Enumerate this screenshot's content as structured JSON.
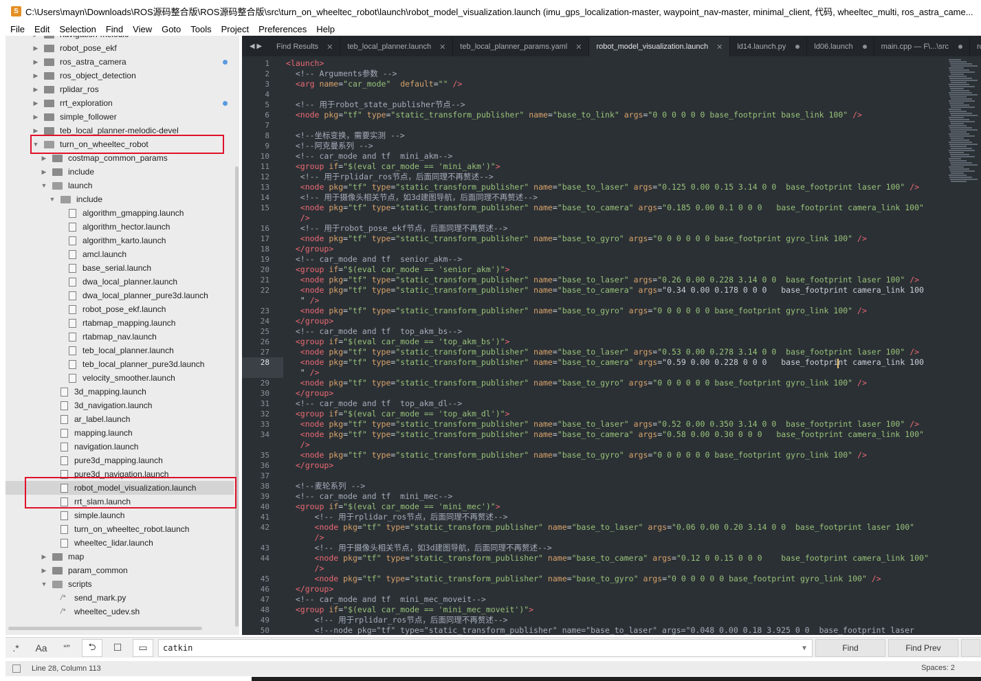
{
  "window": {
    "title": "C:\\Users\\mayn\\Downloads\\ROS源码整合版\\ROS源码整合版\\src\\turn_on_wheeltec_robot\\launch\\robot_model_visualization.launch (imu_gps_localization-master, waypoint_nav-master, minimal_client, 代码, wheeltec_multi, ros_astra_came..."
  },
  "menu": [
    "File",
    "Edit",
    "Selection",
    "Find",
    "View",
    "Goto",
    "Tools",
    "Project",
    "Preferences",
    "Help"
  ],
  "sidebar": {
    "items": [
      {
        "label": "navigation-melodic",
        "type": "folder",
        "depth": 0,
        "expanded": false
      },
      {
        "label": "robot_pose_ekf",
        "type": "folder",
        "depth": 0,
        "expanded": false
      },
      {
        "label": "ros_astra_camera",
        "type": "folder",
        "depth": 0,
        "expanded": false,
        "modified": true
      },
      {
        "label": "ros_object_detection",
        "type": "folder",
        "depth": 0,
        "expanded": false
      },
      {
        "label": "rplidar_ros",
        "type": "folder",
        "depth": 0,
        "expanded": false
      },
      {
        "label": "rrt_exploration",
        "type": "folder",
        "depth": 0,
        "expanded": false,
        "modified": true
      },
      {
        "label": "simple_follower",
        "type": "folder",
        "depth": 0,
        "expanded": false
      },
      {
        "label": "teb_local_planner-melodic-devel",
        "type": "folder",
        "depth": 0,
        "expanded": false
      },
      {
        "label": "turn_on_wheeltec_robot",
        "type": "folder",
        "depth": 0,
        "expanded": true
      },
      {
        "label": "costmap_common_params",
        "type": "folder",
        "depth": 1,
        "expanded": false
      },
      {
        "label": "include",
        "type": "folder",
        "depth": 1,
        "expanded": false
      },
      {
        "label": "launch",
        "type": "folder",
        "depth": 1,
        "expanded": true
      },
      {
        "label": "include",
        "type": "folder",
        "depth": 2,
        "expanded": true
      },
      {
        "label": "algorithm_gmapping.launch",
        "type": "file",
        "depth": 3
      },
      {
        "label": "algorithm_hector.launch",
        "type": "file",
        "depth": 3
      },
      {
        "label": "algorithm_karto.launch",
        "type": "file",
        "depth": 3
      },
      {
        "label": "amcl.launch",
        "type": "file",
        "depth": 3
      },
      {
        "label": "base_serial.launch",
        "type": "file",
        "depth": 3
      },
      {
        "label": "dwa_local_planner.launch",
        "type": "file",
        "depth": 3
      },
      {
        "label": "dwa_local_planner_pure3d.launch",
        "type": "file",
        "depth": 3
      },
      {
        "label": "robot_pose_ekf.launch",
        "type": "file",
        "depth": 3
      },
      {
        "label": "rtabmap_mapping.launch",
        "type": "file",
        "depth": 3
      },
      {
        "label": "rtabmap_nav.launch",
        "type": "file",
        "depth": 3
      },
      {
        "label": "teb_local_planner.launch",
        "type": "file",
        "depth": 3
      },
      {
        "label": "teb_local_planner_pure3d.launch",
        "type": "file",
        "depth": 3
      },
      {
        "label": "velocity_smoother.launch",
        "type": "file",
        "depth": 3
      },
      {
        "label": "3d_mapping.launch",
        "type": "file",
        "depth": 2
      },
      {
        "label": "3d_navigation.launch",
        "type": "file",
        "depth": 2
      },
      {
        "label": "ar_label.launch",
        "type": "file",
        "depth": 2
      },
      {
        "label": "mapping.launch",
        "type": "file",
        "depth": 2
      },
      {
        "label": "navigation.launch",
        "type": "file",
        "depth": 2
      },
      {
        "label": "pure3d_mapping.launch",
        "type": "file",
        "depth": 2
      },
      {
        "label": "pure3d_navigation.launch",
        "type": "file",
        "depth": 2
      },
      {
        "label": "robot_model_visualization.launch",
        "type": "file",
        "depth": 2,
        "selected": true
      },
      {
        "label": "rrt_slam.launch",
        "type": "file",
        "depth": 2
      },
      {
        "label": "simple.launch",
        "type": "file",
        "depth": 2
      },
      {
        "label": "turn_on_wheeltec_robot.launch",
        "type": "file",
        "depth": 2
      },
      {
        "label": "wheeltec_lidar.launch",
        "type": "file",
        "depth": 2
      },
      {
        "label": "map",
        "type": "folder",
        "depth": 1,
        "expanded": false
      },
      {
        "label": "param_common",
        "type": "folder",
        "depth": 1,
        "expanded": false
      },
      {
        "label": "scripts",
        "type": "folder",
        "depth": 1,
        "expanded": true
      },
      {
        "label": "send_mark.py",
        "type": "script",
        "depth": 2
      },
      {
        "label": "wheeltec_udev.sh",
        "type": "script",
        "depth": 2
      }
    ]
  },
  "tabs": [
    {
      "label": "Find Results",
      "state": "close"
    },
    {
      "label": "teb_local_planner.launch",
      "state": "close"
    },
    {
      "label": "teb_local_planner_params.yaml",
      "state": "close"
    },
    {
      "label": "robot_model_visualization.launch",
      "state": "close",
      "active": true
    },
    {
      "label": "ld14.launch.py",
      "state": "dot"
    },
    {
      "label": "ld06.launch",
      "state": "dot"
    },
    {
      "label": "main.cpp — F\\...\\src",
      "state": "dot"
    },
    {
      "label": "rc",
      "state": "none"
    }
  ],
  "editor": {
    "current_line": 28,
    "lines": [
      {
        "n": "1",
        "text": "<launch>"
      },
      {
        "n": "2",
        "text": "  <!-- Arguments参数 -->"
      },
      {
        "n": "3",
        "text": "  <arg name=\"car_mode\"  default=\"\" />"
      },
      {
        "n": "4",
        "text": ""
      },
      {
        "n": "5",
        "text": "  <!-- 用于robot_state_publisher节点-->"
      },
      {
        "n": "6",
        "text": "  <node pkg=\"tf\" type=\"static_transform_publisher\" name=\"base_to_link\" args=\"0 0 0 0 0 0 base_footprint base_link 100\" />"
      },
      {
        "n": "7",
        "text": ""
      },
      {
        "n": "8",
        "text": "  <!--坐标变换，需要实测 -->"
      },
      {
        "n": "9",
        "text": "  <!--阿克曼系列 -->"
      },
      {
        "n": "10",
        "text": "  <!-- car_mode and tf  mini_akm-->"
      },
      {
        "n": "11",
        "text": "  <group if=\"$(eval car_mode == 'mini_akm')\">"
      },
      {
        "n": "12",
        "text": "   <!-- 用于rplidar_ros节点，后面同理不再赘述-->"
      },
      {
        "n": "13",
        "text": "   <node pkg=\"tf\" type=\"static_transform_publisher\" name=\"base_to_laser\" args=\"0.125 0.00 0.15 3.14 0 0  base_footprint laser 100\" />"
      },
      {
        "n": "14",
        "text": "   <!-- 用于摄像头相关节点，如3d建图导航，后面同理不再赘述-->"
      },
      {
        "n": "15",
        "text": "   <node pkg=\"tf\" type=\"static_transform_publisher\" name=\"base_to_camera\" args=\"0.185 0.00 0.1 0 0 0   base_footprint camera_link 100\""
      },
      {
        "n": "",
        "text": "   />"
      },
      {
        "n": "16",
        "text": "   <!-- 用于robot_pose_ekf节点，后面同理不再赘述-->"
      },
      {
        "n": "17",
        "text": "   <node pkg=\"tf\" type=\"static_transform_publisher\" name=\"base_to_gyro\" args=\"0 0 0 0 0 0 base_footprint gyro_link 100\" />"
      },
      {
        "n": "18",
        "text": "  </group>"
      },
      {
        "n": "19",
        "text": "  <!-- car_mode and tf  senior_akm-->"
      },
      {
        "n": "20",
        "text": "  <group if=\"$(eval car_mode == 'senior_akm')\">"
      },
      {
        "n": "21",
        "text": "   <node pkg=\"tf\" type=\"static_transform_publisher\" name=\"base_to_laser\" args=\"0.26 0.00 0.228 3.14 0 0  base_footprint laser 100\" />"
      },
      {
        "n": "22",
        "text": "   <node pkg=\"tf\" type=\"static_transform_publisher\" name=\"base_to_camera\" args=\"0.34 0.00 0.178 0 0 0   base_footprint camera_link 100"
      },
      {
        "n": "",
        "text": "   \" />"
      },
      {
        "n": "23",
        "text": "   <node pkg=\"tf\" type=\"static_transform_publisher\" name=\"base_to_gyro\" args=\"0 0 0 0 0 0 base_footprint gyro_link 100\" />"
      },
      {
        "n": "24",
        "text": "  </group>"
      },
      {
        "n": "25",
        "text": "  <!-- car_mode and tf  top_akm_bs-->"
      },
      {
        "n": "26",
        "text": "  <group if=\"$(eval car_mode == 'top_akm_bs')\">"
      },
      {
        "n": "27",
        "text": "   <node pkg=\"tf\" type=\"static_transform_publisher\" name=\"base_to_laser\" args=\"0.53 0.00 0.278 3.14 0 0  base_footprint laser 100\" />"
      },
      {
        "n": "28",
        "text": "   <node pkg=\"tf\" type=\"static_transform_publisher\" name=\"base_to_camera\" args=\"0.59 0.00 0.228 0 0 0   base_footprint camera_link 100"
      },
      {
        "n": "",
        "text": "   \" />"
      },
      {
        "n": "29",
        "text": "   <node pkg=\"tf\" type=\"static_transform_publisher\" name=\"base_to_gyro\" args=\"0 0 0 0 0 0 base_footprint gyro_link 100\" />"
      },
      {
        "n": "30",
        "text": "  </group>"
      },
      {
        "n": "31",
        "text": "  <!-- car_mode and tf  top_akm_dl-->"
      },
      {
        "n": "32",
        "text": "  <group if=\"$(eval car_mode == 'top_akm_dl')\">"
      },
      {
        "n": "33",
        "text": "   <node pkg=\"tf\" type=\"static_transform_publisher\" name=\"base_to_laser\" args=\"0.52 0.00 0.350 3.14 0 0  base_footprint laser 100\" />"
      },
      {
        "n": "34",
        "text": "   <node pkg=\"tf\" type=\"static_transform_publisher\" name=\"base_to_camera\" args=\"0.58 0.00 0.30 0 0 0   base_footprint camera_link 100\""
      },
      {
        "n": "",
        "text": "   />"
      },
      {
        "n": "35",
        "text": "   <node pkg=\"tf\" type=\"static_transform_publisher\" name=\"base_to_gyro\" args=\"0 0 0 0 0 0 base_footprint gyro_link 100\" />"
      },
      {
        "n": "36",
        "text": "  </group>"
      },
      {
        "n": "37",
        "text": ""
      },
      {
        "n": "38",
        "text": "  <!--麦轮系列 -->"
      },
      {
        "n": "39",
        "text": "  <!-- car_mode and tf  mini_mec-->"
      },
      {
        "n": "40",
        "text": "  <group if=\"$(eval car_mode == 'mini_mec')\">"
      },
      {
        "n": "41",
        "text": "      <!-- 用于rplidar_ros节点，后面同理不再赘述-->"
      },
      {
        "n": "42",
        "text": "      <node pkg=\"tf\" type=\"static_transform_publisher\" name=\"base_to_laser\" args=\"0.06 0.00 0.20 3.14 0 0  base_footprint laser 100\""
      },
      {
        "n": "",
        "text": "      />"
      },
      {
        "n": "43",
        "text": "      <!-- 用于摄像头相关节点，如3d建图导航，后面同理不再赘述-->"
      },
      {
        "n": "44",
        "text": "      <node pkg=\"tf\" type=\"static_transform_publisher\" name=\"base_to_camera\" args=\"0.12 0 0.15 0 0 0    base_footprint camera_link 100\""
      },
      {
        "n": "",
        "text": "      />"
      },
      {
        "n": "45",
        "text": "      <node pkg=\"tf\" type=\"static_transform_publisher\" name=\"base_to_gyro\" args=\"0 0 0 0 0 0 base_footprint gyro_link 100\" />"
      },
      {
        "n": "46",
        "text": "  </group>"
      },
      {
        "n": "47",
        "text": "  <!-- car_mode and tf  mini_mec_moveit-->"
      },
      {
        "n": "48",
        "text": "  <group if=\"$(eval car_mode == 'mini_mec_moveit')\">"
      },
      {
        "n": "49",
        "text": "      <!-- 用于rplidar_ros节点，后面同理不再赘述-->"
      },
      {
        "n": "50",
        "text": "      <!--node pkg=\"tf\" type=\"static_transform_publisher\" name=\"base_to_laser\" args=\"0.048 0.00 0.18 3.925 0 0  base_footprint laser"
      }
    ]
  },
  "find": {
    "regex_label": ".*",
    "case_label": "Aa",
    "word_label": "“”",
    "wrap_label": "⮌",
    "selection_label": "☐",
    "highlight_label": "▭",
    "value": "catkin",
    "find_button": "Find",
    "find_prev_button": "Find Prev"
  },
  "status": {
    "position": "Line 28, Column 113",
    "spaces": "Spaces: 2"
  },
  "colors": {
    "editor_bg": "#2b3035",
    "tag": "#ec6a73",
    "attribute": "#d9a36a",
    "string": "#98c379",
    "comment": "#a7adba",
    "highlight_box": "#e0102a",
    "modified_dot": "#5a9be0"
  }
}
